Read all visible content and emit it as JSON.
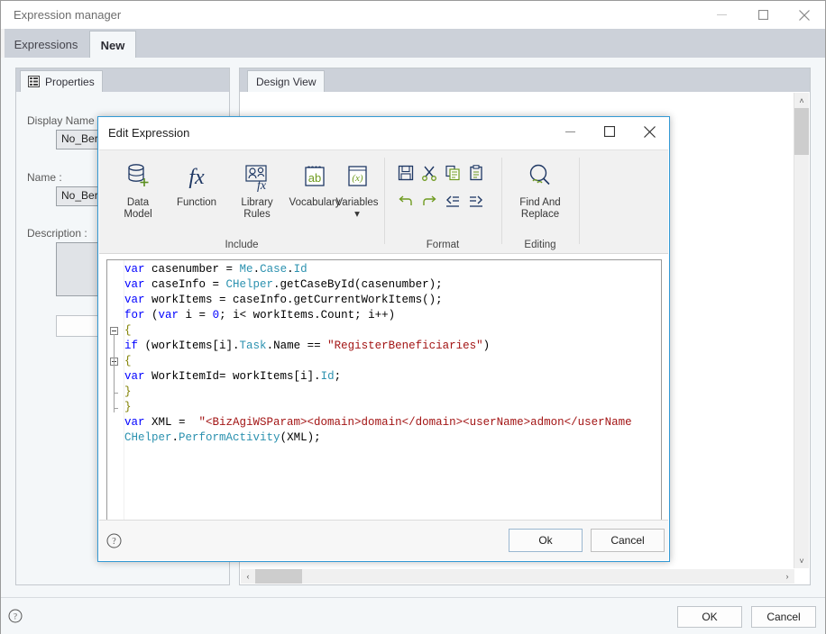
{
  "window": {
    "title": "Expression manager",
    "controls": [
      {
        "name": "minimize",
        "glyph": "minimize-icon"
      },
      {
        "name": "maximize",
        "glyph": "maximize-icon"
      },
      {
        "name": "close",
        "glyph": "close-icon"
      }
    ],
    "tabs": [
      {
        "label": "Expressions",
        "active": false
      },
      {
        "label": "New",
        "active": true
      }
    ],
    "footer": {
      "help": "?",
      "ok_label": "OK",
      "cancel_label": "Cancel"
    }
  },
  "left_panel": {
    "tab_label": "Properties",
    "tab_icon": "properties-grid-icon",
    "fields": [
      {
        "label": "Display Name",
        "value": "No_Ber"
      },
      {
        "label": "Name :",
        "value": "No_Ber"
      },
      {
        "label": "Description :",
        "value": ""
      }
    ]
  },
  "right_panel": {
    "tab_label": "Design View",
    "play_icon": "play-button-icon",
    "scroll": {
      "up": "˄",
      "down": "˅",
      "left": "‹",
      "right": "›"
    }
  },
  "dialog": {
    "title": "Edit Expression",
    "controls": [
      {
        "name": "minimize",
        "glyph": "minimize-icon"
      },
      {
        "name": "maximize",
        "glyph": "maximize-icon"
      },
      {
        "name": "close",
        "glyph": "close-icon"
      }
    ],
    "ribbon": {
      "groups": [
        {
          "name": "Include",
          "label": "Include",
          "items": [
            {
              "label1": "Data",
              "label2": "Model",
              "icon": "data-model-icon"
            },
            {
              "label1": "Function",
              "label2": "",
              "icon": "function-fx-icon"
            },
            {
              "label1": "Library",
              "label2": "Rules",
              "icon": "library-rules-icon"
            },
            {
              "label1": "Vocabulary",
              "label2": "",
              "icon": "vocabulary-notepad-icon"
            },
            {
              "label1": "Variables",
              "label2": "▾",
              "icon": "variables-x-icon"
            }
          ]
        },
        {
          "name": "Format",
          "label": "Format",
          "items": [
            {
              "icon": "save-icon"
            },
            {
              "icon": "cut-scissors-icon"
            },
            {
              "icon": "copy-icon"
            },
            {
              "icon": "paste-clipboard-icon"
            },
            {
              "icon": "undo-icon"
            },
            {
              "icon": "redo-icon"
            },
            {
              "icon": "outdent-icon"
            },
            {
              "icon": "indent-icon"
            }
          ]
        },
        {
          "name": "Editing",
          "label": "Editing",
          "items": [
            {
              "label1": "Find And",
              "label2": "Replace",
              "icon": "find-and-replace-icon"
            }
          ]
        }
      ]
    },
    "editor": {
      "lines": [
        {
          "fold": "none",
          "tokens": [
            {
              "t": "var",
              "c": "kw"
            },
            {
              "t": " casenumber = ",
              "c": "plain"
            },
            {
              "t": "Me",
              "c": "type"
            },
            {
              "t": ".",
              "c": "plain"
            },
            {
              "t": "Case",
              "c": "type"
            },
            {
              "t": ".",
              "c": "plain"
            },
            {
              "t": "Id",
              "c": "type"
            }
          ]
        },
        {
          "fold": "none",
          "tokens": [
            {
              "t": "var",
              "c": "kw"
            },
            {
              "t": " caseInfo = ",
              "c": "plain"
            },
            {
              "t": "CHelper",
              "c": "type"
            },
            {
              "t": ".getCaseById(casenumber);",
              "c": "plain"
            }
          ]
        },
        {
          "fold": "none",
          "tokens": [
            {
              "t": "var",
              "c": "kw"
            },
            {
              "t": " workItems = caseInfo.getCurrentWorkItems();",
              "c": "plain"
            }
          ]
        },
        {
          "fold": "none",
          "tokens": [
            {
              "t": "for",
              "c": "kw"
            },
            {
              "t": " (",
              "c": "plain"
            },
            {
              "t": "var",
              "c": "kw"
            },
            {
              "t": " i = ",
              "c": "plain"
            },
            {
              "t": "0",
              "c": "num"
            },
            {
              "t": "; i< workItems.Count; i++)",
              "c": "plain"
            }
          ]
        },
        {
          "fold": "open",
          "tokens": [
            {
              "t": "{",
              "c": "brace"
            }
          ]
        },
        {
          "fold": "bar",
          "tokens": [
            {
              "t": "if",
              "c": "kw"
            },
            {
              "t": " (workItems[i].",
              "c": "plain"
            },
            {
              "t": "Task",
              "c": "type"
            },
            {
              "t": ".Name == ",
              "c": "plain"
            },
            {
              "t": "\"RegisterBeneficiaries\"",
              "c": "str"
            },
            {
              "t": ")",
              "c": "plain"
            }
          ]
        },
        {
          "fold": "open2",
          "tokens": [
            {
              "t": "{",
              "c": "brace"
            }
          ]
        },
        {
          "fold": "bar2",
          "tokens": [
            {
              "t": "var",
              "c": "kw"
            },
            {
              "t": " WorkItemId= workItems[i].",
              "c": "plain"
            },
            {
              "t": "Id",
              "c": "type"
            },
            {
              "t": ";",
              "c": "plain"
            }
          ]
        },
        {
          "fold": "end2",
          "tokens": [
            {
              "t": "}",
              "c": "brace"
            }
          ]
        },
        {
          "fold": "end",
          "tokens": [
            {
              "t": "}",
              "c": "brace"
            }
          ]
        },
        {
          "fold": "none",
          "tokens": [
            {
              "t": "var",
              "c": "kw"
            },
            {
              "t": " XML =  ",
              "c": "plain"
            },
            {
              "t": "\"<BizAgiWSParam><domain>domain</domain><userName>admon</userName",
              "c": "str"
            }
          ]
        },
        {
          "fold": "none",
          "tokens": [
            {
              "t": "CHelper",
              "c": "type"
            },
            {
              "t": ".",
              "c": "plain"
            },
            {
              "t": "PerformActivity",
              "c": "type"
            },
            {
              "t": "(XML);",
              "c": "plain"
            }
          ]
        }
      ],
      "scroll": {
        "left": "‹",
        "right": "›"
      }
    },
    "footer": {
      "help": "?",
      "ok_label": "Ok",
      "cancel_label": "Cancel"
    }
  },
  "colors": {
    "accent_blue": "#3399d4",
    "tab_bar": "#ccd1d9",
    "keyword": "#0000ff",
    "type": "#2b91af",
    "string": "#a31515",
    "brace": "#808000",
    "play_green": "#2fa024"
  }
}
